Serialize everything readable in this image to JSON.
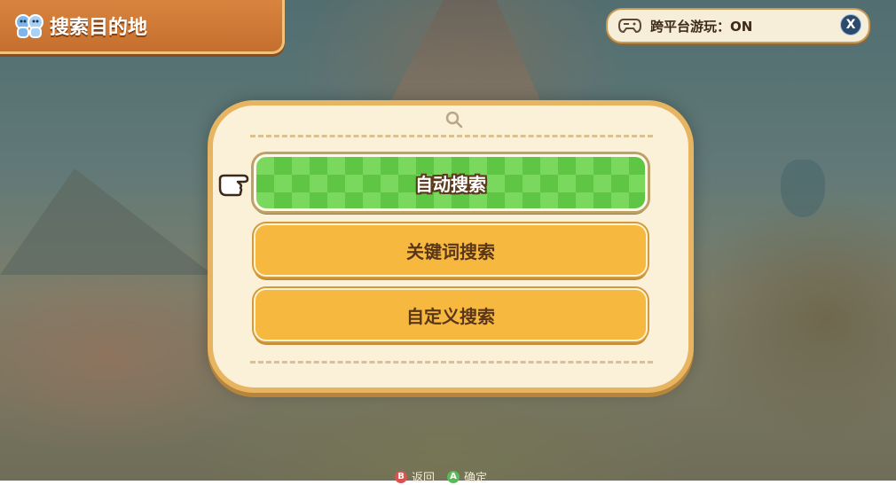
{
  "header": {
    "title": "搜索目的地",
    "icon": "pets-icon"
  },
  "crossplay": {
    "label": "跨平台游玩：ON",
    "button": "X",
    "icon": "controller-icon"
  },
  "dialog": {
    "search_icon": "search-icon",
    "options": [
      {
        "label": "自动搜索",
        "selected": true
      },
      {
        "label": "关键词搜索",
        "selected": false
      },
      {
        "label": "自定义搜索",
        "selected": false
      }
    ]
  },
  "footer": {
    "back": {
      "button": "B",
      "label": "返回"
    },
    "confirm": {
      "button": "A",
      "label": "确定"
    }
  },
  "colors": {
    "accent_green": "#7bd85e",
    "option_orange": "#f6b83e",
    "dialog_bg": "#fbf1d8",
    "banner_orange": "#d8843f"
  }
}
